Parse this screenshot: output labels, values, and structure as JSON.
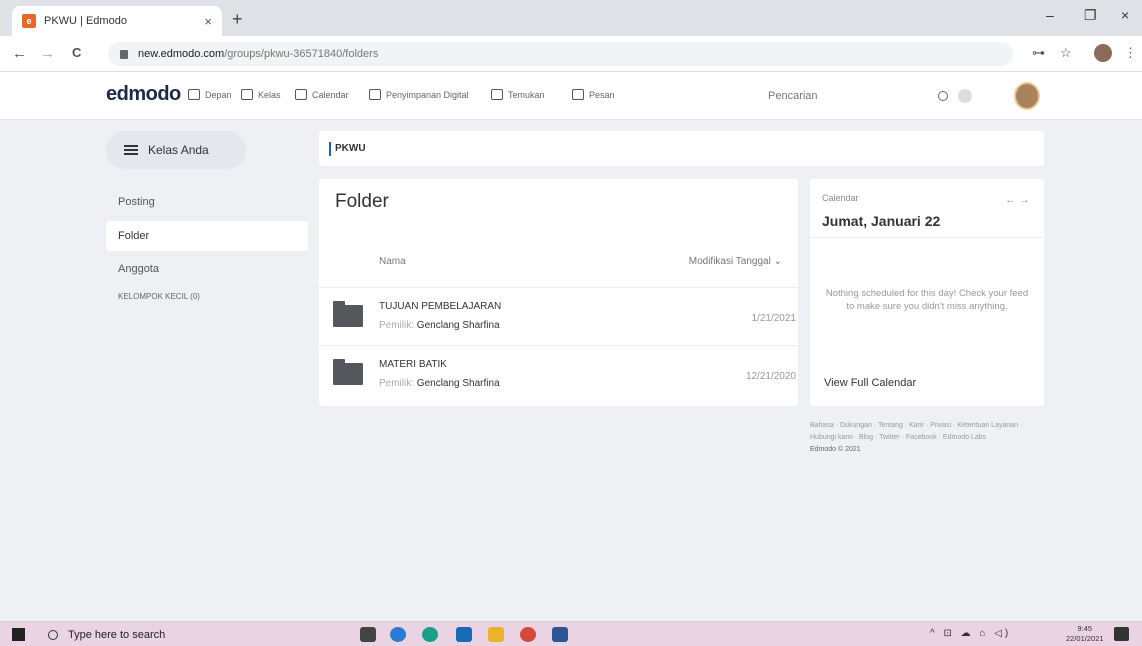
{
  "browser": {
    "tab_title": "PKWU | Edmodo",
    "tab_close": "×",
    "new_tab": "+",
    "favicon_letter": "e",
    "url_domain": "new.edmodo.com",
    "url_path": "/groups/pkwu-36571840/folders",
    "nav_back": "←",
    "nav_forward": "→",
    "nav_reload": "C",
    "key_icon": "⊶",
    "star_icon": "☆",
    "menu_icon": "⋮",
    "min": "–",
    "max": "❐",
    "close": "×"
  },
  "nav": {
    "logo": "edmodo",
    "items": [
      {
        "label": "Depan",
        "icon": "home-icon"
      },
      {
        "label": "Kelas",
        "icon": "class-icon"
      },
      {
        "label": "Calendar",
        "icon": "calendar-icon"
      },
      {
        "label": "Penyimpanan Digital",
        "icon": "backpack-icon"
      },
      {
        "label": "Temukan",
        "icon": "discover-icon"
      },
      {
        "label": "Pesan",
        "icon": "message-icon"
      }
    ],
    "search_placeholder": "Pencarian"
  },
  "sidebar": {
    "class_button": "Kelas Anda",
    "items": [
      {
        "label": "Posting",
        "active": false
      },
      {
        "label": "Folder",
        "active": true
      },
      {
        "label": "Anggota",
        "active": false
      },
      {
        "label": "KELOMPOK KECIL (0)",
        "active": false
      }
    ]
  },
  "group": {
    "name": "PKWU"
  },
  "folder_panel": {
    "title": "Folder",
    "col_name": "Nama",
    "col_modified": "Modifikasi Tanggal ⌄",
    "owner_prefix": "Pemilik:",
    "rows": [
      {
        "name": "TUJUAN PEMBELAJARAN",
        "owner": "Genclang Sharfina",
        "date": "1/21/2021"
      },
      {
        "name": "MATERI BATIK",
        "owner": "Genclang Sharfina",
        "date": "12/21/2020"
      }
    ]
  },
  "calendar": {
    "label": "Calendar",
    "arrows": "← →",
    "date": "Jumat, Januari 22",
    "empty_message": "Nothing scheduled for this day! Check your feed to make sure you didn't miss anything.",
    "view_full": "View Full Calendar"
  },
  "footer": {
    "links": "Bahasa · Dukungan · Tentang · Karir · Privasi · Ketentuan Layanan · Hubungi kami · Blog · Twitter · Facebook · Edmodo Labs",
    "copyright": "Edmodo © 2021"
  },
  "taskbar": {
    "search_placeholder": "Type here to search",
    "systray": "^ ⊡ ☁ ⌂ ◁)",
    "time": "9:45",
    "date": "22/01/2021"
  }
}
